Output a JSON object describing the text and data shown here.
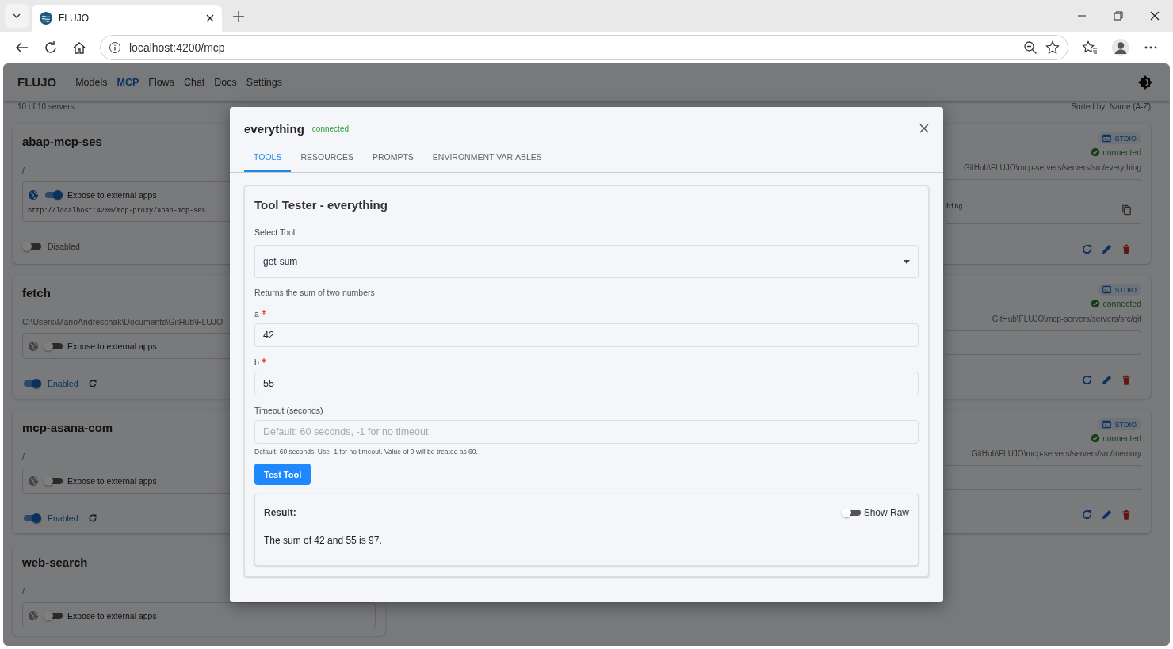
{
  "browser": {
    "tab_title": "FLUJO",
    "url": "localhost:4200/mcp"
  },
  "app": {
    "logo": "FLUJO",
    "nav": [
      {
        "label": "Models",
        "selected": false
      },
      {
        "label": "MCP",
        "selected": true
      },
      {
        "label": "Flows",
        "selected": false
      },
      {
        "label": "Chat",
        "selected": false
      },
      {
        "label": "Docs",
        "selected": false
      },
      {
        "label": "Settings",
        "selected": false
      }
    ]
  },
  "summary": {
    "count": "10 of 10 servers",
    "sort": "Sorted by: Name (A-Z)"
  },
  "servers_left": [
    {
      "name": "abap-mcp-ses",
      "path": "/",
      "expose": {
        "on": true,
        "label": "Expose to external apps",
        "url": "http://localhost:4200/mcp-proxy/abap-mcp-ses"
      },
      "enabled": false,
      "state_label": "Disabled"
    },
    {
      "name": "fetch",
      "path": "C:\\Users\\MarioAndreschak\\Documents\\GitHub\\FLUJO",
      "expose": {
        "on": false,
        "label": "Expose to external apps"
      },
      "enabled": true,
      "state_label": "Enabled"
    },
    {
      "name": "mcp-asana-com",
      "path": "/",
      "expose": {
        "on": false,
        "label": "Expose to external apps"
      },
      "enabled": true,
      "state_label": "Enabled"
    },
    {
      "name": "web-search",
      "path": "/",
      "expose": {
        "on": false,
        "label": "Expose to external apps"
      }
    }
  ],
  "servers_right": [
    {
      "transport": "STDIO",
      "status": "connected",
      "path": "GitHub\\FLUJO\\mcp-servers/servers/src/everything",
      "url_tail": "hing"
    },
    {
      "transport": "STDIO",
      "status": "connected",
      "path": "GitHub\\FLUJO\\mcp-servers/servers/src/git"
    },
    {
      "transport": "STDIO",
      "status": "connected",
      "path": "GitHub\\FLUJO\\mcp-servers/servers/src/memory"
    }
  ],
  "modal": {
    "title": "everything",
    "status": "connected",
    "tabs": [
      {
        "label": "TOOLS",
        "selected": true
      },
      {
        "label": "RESOURCES",
        "selected": false
      },
      {
        "label": "PROMPTS",
        "selected": false
      },
      {
        "label": "ENVIRONMENT VARIABLES",
        "selected": false
      }
    ],
    "tool_tester": {
      "heading": "Tool Tester - everything",
      "select_label": "Select Tool",
      "selected_tool": "get-sum",
      "description": "Returns the sum of two numbers",
      "params": [
        {
          "label": "a",
          "required": true,
          "value": "42"
        },
        {
          "label": "b",
          "required": true,
          "value": "55"
        },
        {
          "label": "Timeout (seconds)",
          "required": false,
          "placeholder": "Default: 60 seconds, -1 for no timeout",
          "helper": "Default: 60 seconds. Use -1 for no timeout. Value of 0 will be treated as 60."
        }
      ],
      "button": "Test Tool",
      "result": {
        "label": "Result:",
        "show_raw_label": "Show Raw",
        "show_raw": false,
        "text": "The sum of 42 and 55 is 97."
      }
    }
  }
}
